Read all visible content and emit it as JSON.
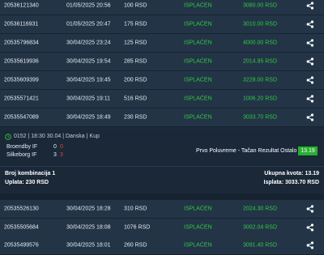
{
  "tickets_top": [
    {
      "id": "20536121340",
      "datetime": "01/05/2025 20:56",
      "amount": "100 RSD",
      "status": "ISPLAĆEN",
      "win": "3080.00 RSD"
    },
    {
      "id": "20536116931",
      "datetime": "01/05/2025 20:47",
      "amount": "175 RSD",
      "status": "ISPLAĆEN",
      "win": "3010.00 RSD"
    },
    {
      "id": "20535796834",
      "datetime": "30/04/2025 23:24",
      "amount": "125 RSD",
      "status": "ISPLAĆEN",
      "win": "4000.00 RSD"
    },
    {
      "id": "20535619936",
      "datetime": "30/04/2025 19:54",
      "amount": "285 RSD",
      "status": "ISPLAĆEN",
      "win": "2014.95 RSD"
    },
    {
      "id": "20535609399",
      "datetime": "30/04/2025 19:45",
      "amount": "200 RSD",
      "status": "ISPLAĆEN",
      "win": "3228.00 RSD"
    },
    {
      "id": "20535571421",
      "datetime": "30/04/2025 19:11",
      "amount": "516 RSD",
      "status": "ISPLAĆEN",
      "win": "1006.20 RSD"
    },
    {
      "id": "20535547089",
      "datetime": "30/04/2025 18:49",
      "amount": "230 RSD",
      "status": "ISPLAĆEN",
      "win": "3033.70 RSD"
    }
  ],
  "ticket_detail": {
    "match_info": "0152 | 18:30 30.04 | Danska | Kup",
    "home_team": "Broendby IF",
    "home_score_ht": "0",
    "home_score_ft": "0",
    "away_team": "Silkeborg IF",
    "away_score_ht": "3",
    "away_score_ft": "3",
    "market": "Prvo Poluvreme - Tačan Rezultat Ostalo",
    "odd": "13.19",
    "combinations": "Broj kombinacija 1",
    "stake": "Uplata: 230 RSD",
    "total_odds": "Ukupna kvota: 13.19",
    "payout": "Isplata: 3033.70 RSD"
  },
  "tickets_bottom": [
    {
      "id": "20535526130",
      "datetime": "30/04/2025 18:28",
      "amount": "310 RSD",
      "status": "ISPLAĆEN",
      "win": "2024.30 RSD"
    },
    {
      "id": "20535505684",
      "datetime": "30/04/2025 18:08",
      "amount": "1076 RSD",
      "status": "ISPLAĆEN",
      "win": "3002.04 RSD"
    },
    {
      "id": "20535499576",
      "datetime": "30/04/2025 18:01",
      "amount": "260 RSD",
      "status": "ISPLAĆEN",
      "win": "3091.40 RSD"
    }
  ],
  "colors": {
    "row_bg": "#233447",
    "status_green": "#2ecc40",
    "odd_badge": "#27b02f",
    "loss_red": "#e0463c"
  },
  "icons": {
    "share": "share-icon",
    "clock": "clock-icon"
  }
}
